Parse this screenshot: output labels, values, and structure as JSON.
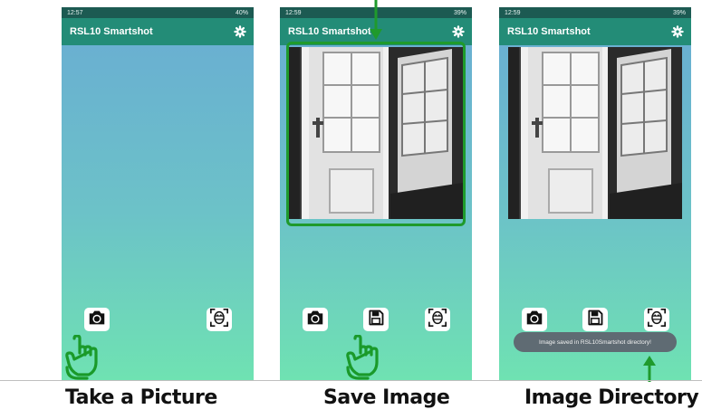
{
  "app_title": "RSL10 Smartshot",
  "screens": [
    {
      "time": "12:57",
      "status_right": "40%",
      "caption": "Take a Picture"
    },
    {
      "time": "12:59",
      "status_right": "39%",
      "caption": "Save Image"
    },
    {
      "time": "12:59",
      "status_right": "39%",
      "caption": "Image Directory"
    }
  ],
  "toast": "Image saved in RSL10Smartshot directory!",
  "icons": {
    "settings": "gear-icon",
    "camera": "camera-icon",
    "save": "floppy-disk-icon",
    "gallery": "face-scan-icon",
    "hand": "tap-hand-icon",
    "arrow": "arrow-icon"
  },
  "colors": {
    "appbar": "#238c77",
    "statusbar": "#1c5a52",
    "gradient_top": "#69acd3",
    "gradient_bottom": "#6fe2b2",
    "highlight": "#1f9a2c",
    "toast_bg": "#5f6b73"
  }
}
